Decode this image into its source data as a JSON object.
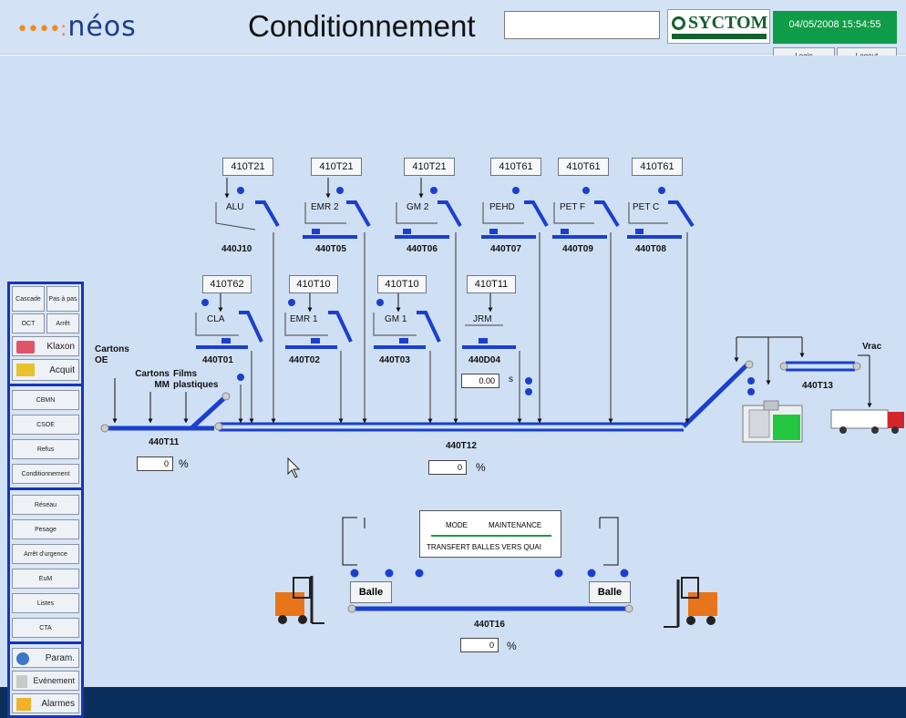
{
  "header": {
    "logo": "néos",
    "title": "Conditionnement",
    "brand": "SYCTOM",
    "datetime": "04/05/2008 15:54:55",
    "login_label": "Login",
    "logout_label": "Logout"
  },
  "sidebar": {
    "top_buttons": [
      "Cascade",
      "Pas à pas",
      "OCT",
      "Arrêt"
    ],
    "klaxon": "Klaxon",
    "acquit": "Acquit",
    "group1": [
      "CBMN",
      "CSOE",
      "Refus",
      "Conditionnement"
    ],
    "group2": [
      "Réseau",
      "Pesage",
      "Arrêt d'urgence",
      "EuM",
      "Listes",
      "CTA"
    ],
    "param": "Param.",
    "evenement": "Evénement",
    "alarmes": "Alarmes"
  },
  "tags_top": [
    "410T21",
    "410T21",
    "410T21",
    "410T61",
    "410T61",
    "410T61"
  ],
  "hoppers_top": [
    {
      "label": "ALU",
      "code": "440J10"
    },
    {
      "label": "EMR 2",
      "code": "440T05"
    },
    {
      "label": "GM 2",
      "code": "440T06"
    },
    {
      "label": "PEHD",
      "code": "440T07"
    },
    {
      "label": "PET F",
      "code": "440T09"
    },
    {
      "label": "PET C",
      "code": "440T08"
    }
  ],
  "tags_mid": [
    "410T62",
    "410T10",
    "410T10",
    "410T11"
  ],
  "hoppers_mid": [
    {
      "label": "CLA",
      "code": "440T01"
    },
    {
      "label": "EMR 1",
      "code": "440T02"
    },
    {
      "label": "GM 1",
      "code": "440T03"
    },
    {
      "label": "JRM",
      "code": "440D04"
    }
  ],
  "feeds": {
    "cartons_oe": "Cartons OE",
    "cartons_mm": "Cartons MM",
    "films": "Films plastiques",
    "vrac": "Vrac"
  },
  "conveyors": {
    "t11": {
      "code": "440T11",
      "value": "0",
      "unit": "%"
    },
    "t12": {
      "code": "440T12",
      "value": "0",
      "unit": "%"
    },
    "t13": {
      "code": "440T13"
    },
    "t16": {
      "code": "440T16",
      "value": "0",
      "unit": "%"
    }
  },
  "d04_value": "0.00",
  "d04_unit": "s",
  "mode": {
    "label": "MODE",
    "value": "MAINTENANCE",
    "transfer": "TRANSFERT BALLES VERS QUAI"
  },
  "balle_left": "Balle",
  "balle_right": "Balle",
  "colors": {
    "conveyor": "#1a3fd0",
    "canvas": "#cfe0f5",
    "footer": "#0b2f5c"
  }
}
